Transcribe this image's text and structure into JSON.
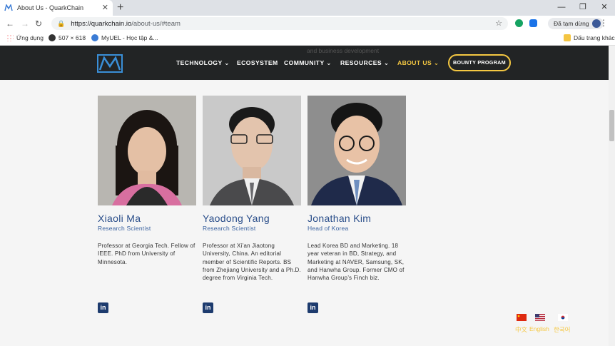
{
  "browser": {
    "tab_title": "About Us - QuarkChain",
    "url_host": "https://quarkchain.io",
    "url_path": "/about-us/#team",
    "profile_label": "Đã tạm dừng",
    "bookmarks": [
      {
        "label": "Ứng dụng"
      },
      {
        "label": "507 × 618"
      },
      {
        "label": "MyUEL - Học tập &..."
      }
    ],
    "other_bookmarks": "Dấu trang khác"
  },
  "site": {
    "nav": [
      {
        "label": "TECHNOLOGY",
        "has_dropdown": true
      },
      {
        "label": "ECOSYSTEM",
        "has_dropdown": false
      },
      {
        "label": "COMMUNITY",
        "has_dropdown": true
      },
      {
        "label": "RESOURCES",
        "has_dropdown": true
      },
      {
        "label": "ABOUT US",
        "has_dropdown": true,
        "active": true
      }
    ],
    "bounty_label": "BOUNTY PROGRAM",
    "ghost_text": "and business development",
    "accent_color": "#f5c842",
    "header_bg": "#222425"
  },
  "team": [
    {
      "name": "Xiaoli Ma",
      "role": "Research Scientist",
      "bio": "Professor at Georgia Tech. Fellow of IEEE. PhD from University of Minnesota."
    },
    {
      "name": "Yaodong Yang",
      "role": "Research Scientist",
      "bio": "Professor at Xi’an Jiaotong University, China. An editorial member of Scientific Reports. BS from Zhejiang University and a Ph.D. degree from Virginia Tech."
    },
    {
      "name": "Jonathan Kim",
      "role": "Head of Korea",
      "bio": "Lead Korea BD and Marketing. 18 year veteran in BD, Strategy, and Marketing at NAVER, Samsung, SK, and Hanwha Group. Former CMO of Hanwha Group’s Finch biz."
    }
  ],
  "languages": [
    {
      "label": "中文",
      "flag": "cn-flag-icon"
    },
    {
      "label": "English",
      "flag": "us-flag-icon"
    },
    {
      "label": "한국어",
      "flag": "kr-flag-icon"
    }
  ]
}
